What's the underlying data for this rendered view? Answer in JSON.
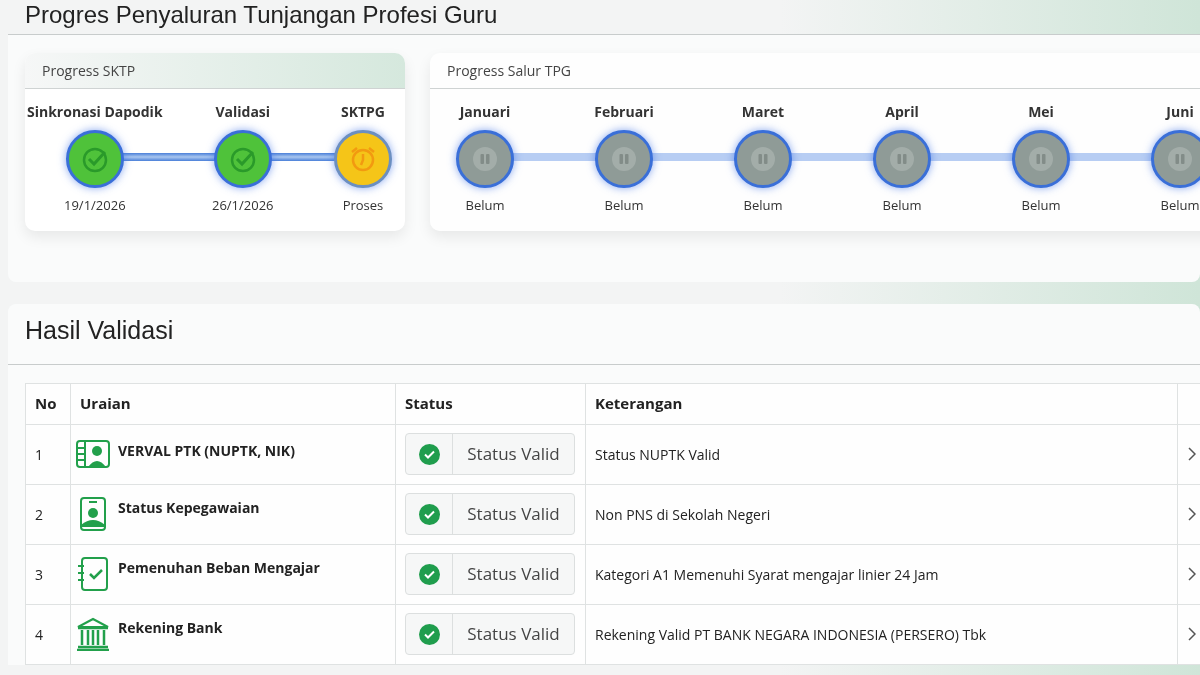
{
  "page_title": "Progres Penyaluran Tunjangan Profesi Guru",
  "sktp": {
    "title": "Progress SKTP",
    "steps": [
      {
        "label": "Sinkronasi Dapodik",
        "status": "19/1/2026",
        "kind": "done"
      },
      {
        "label": "Validasi",
        "status": "26/1/2026",
        "kind": "done"
      },
      {
        "label": "SKTPG",
        "status": "Proses",
        "kind": "process"
      }
    ]
  },
  "salur": {
    "title": "Progress Salur TPG",
    "steps": [
      {
        "label": "Januari",
        "status": "Belum",
        "kind": "pending"
      },
      {
        "label": "Februari",
        "status": "Belum",
        "kind": "pending"
      },
      {
        "label": "Maret",
        "status": "Belum",
        "kind": "pending"
      },
      {
        "label": "April",
        "status": "Belum",
        "kind": "pending"
      },
      {
        "label": "Mei",
        "status": "Belum",
        "kind": "pending"
      },
      {
        "label": "Juni",
        "status": "Belum",
        "kind": "pending"
      }
    ]
  },
  "validation": {
    "title": "Hasil Validasi",
    "columns": [
      "No",
      "Uraian",
      "Status",
      "Keterangan"
    ],
    "rows": [
      {
        "no": "1",
        "kind": "id-card",
        "item": "VERVAL PTK (NUPTK, NIK)",
        "status": "Status Valid",
        "valid": true,
        "note": "Status NUPTK Valid"
      },
      {
        "no": "2",
        "kind": "badge",
        "item": "Status Kepegawaian",
        "status": "Status Valid",
        "valid": true,
        "note": "Non PNS di Sekolah Negeri"
      },
      {
        "no": "3",
        "kind": "checklist",
        "item": "Pemenuhan Beban Mengajar",
        "status": "Status Valid",
        "valid": true,
        "note": "Kategori A1 Memenuhi Syarat mengajar linier 24 Jam"
      },
      {
        "no": "4",
        "kind": "bank",
        "item": "Rekening Bank",
        "status": "Status Valid",
        "valid": true,
        "note": "Rekening Valid PT BANK NEGARA INDONESIA (PERSERO) Tbk"
      }
    ]
  }
}
